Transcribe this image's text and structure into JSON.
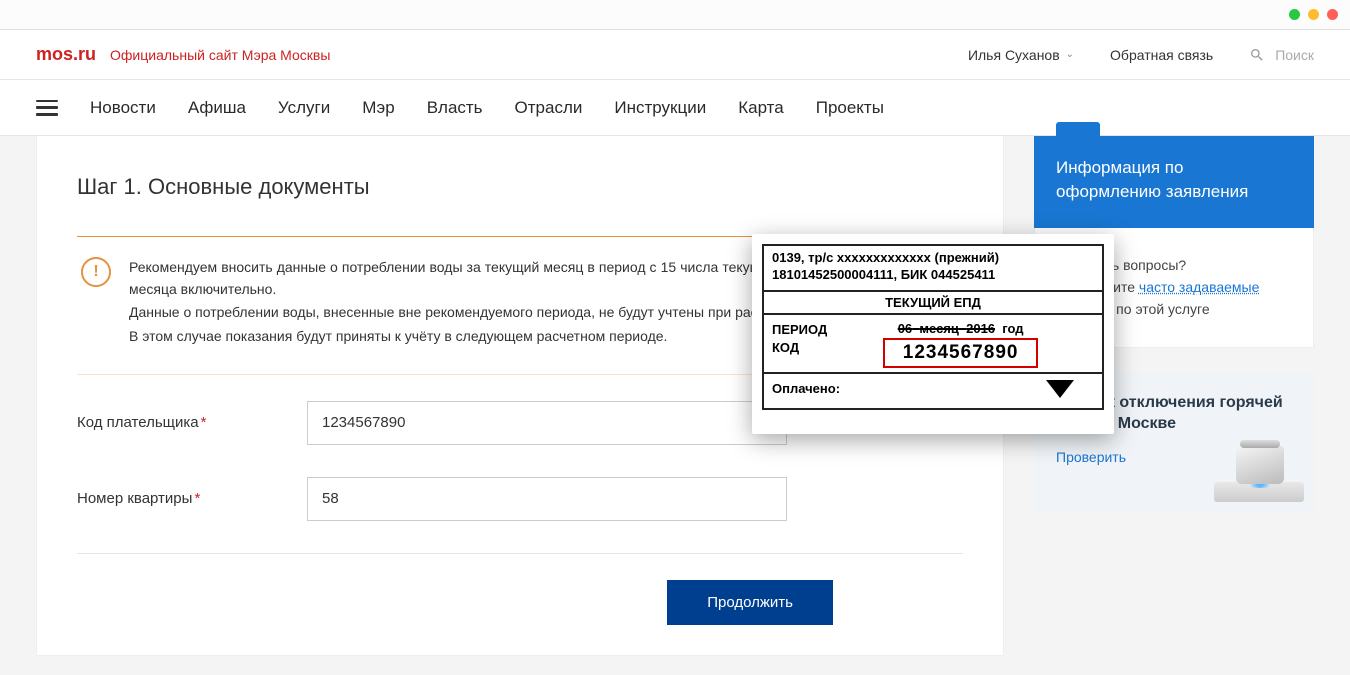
{
  "header": {
    "logo": "mos.ru",
    "logo_subtitle": "Официальный сайт Мэра Москвы",
    "user_name": "Илья Суханов",
    "feedback": "Обратная связь",
    "search_placeholder": "Поиск"
  },
  "nav": {
    "items": [
      "Новости",
      "Афиша",
      "Услуги",
      "Мэр",
      "Власть",
      "Отрасли",
      "Инструкции",
      "Карта",
      "Проекты"
    ]
  },
  "main": {
    "step_title": "Шаг 1. Основные документы",
    "alert": {
      "line1": "Рекомендуем вносить данные о потреблении воды за текущий месяц в период с 15 числа текущего по 3 число следующего месяца включительно.",
      "line2": "Данные о потреблении воды, внесенные вне рекомендуемого периода, не будут учтены при расчете текущего периода.",
      "line3": "В этом случае показания будут приняты к учёту в следующем расчетном периоде."
    },
    "form": {
      "payer_code_label": "Код плательщика",
      "payer_code_value": "1234567890",
      "apartment_label": "Номер квартиры",
      "apartment_value": "58",
      "continue_label": "Продолжить"
    }
  },
  "sidebar": {
    "info_card": "Информация по оформлению заявления",
    "faq_pre": "Остались вопросы?",
    "faq_mid": "Посмотрите ",
    "faq_link": "часто задаваемые вопросы",
    "faq_post": " по этой услуге",
    "promo_title": "График отключения горячей воды в Москве",
    "promo_link": "Проверить"
  },
  "receipt": {
    "line1": "0139, тр/с xxxxxxxxxxxxx (прежний)",
    "line2": "18101452500004111, БИК 044525411",
    "current_label": "ТЕКУЩИЙ ЕПД",
    "period_label": "ПЕРИОД",
    "code_label": "КОД",
    "period_month": "06",
    "period_month_word": "месяц",
    "period_year": "2016",
    "period_year_word": "год",
    "code_value": "1234567890",
    "paid_label": "Оплачено:"
  }
}
